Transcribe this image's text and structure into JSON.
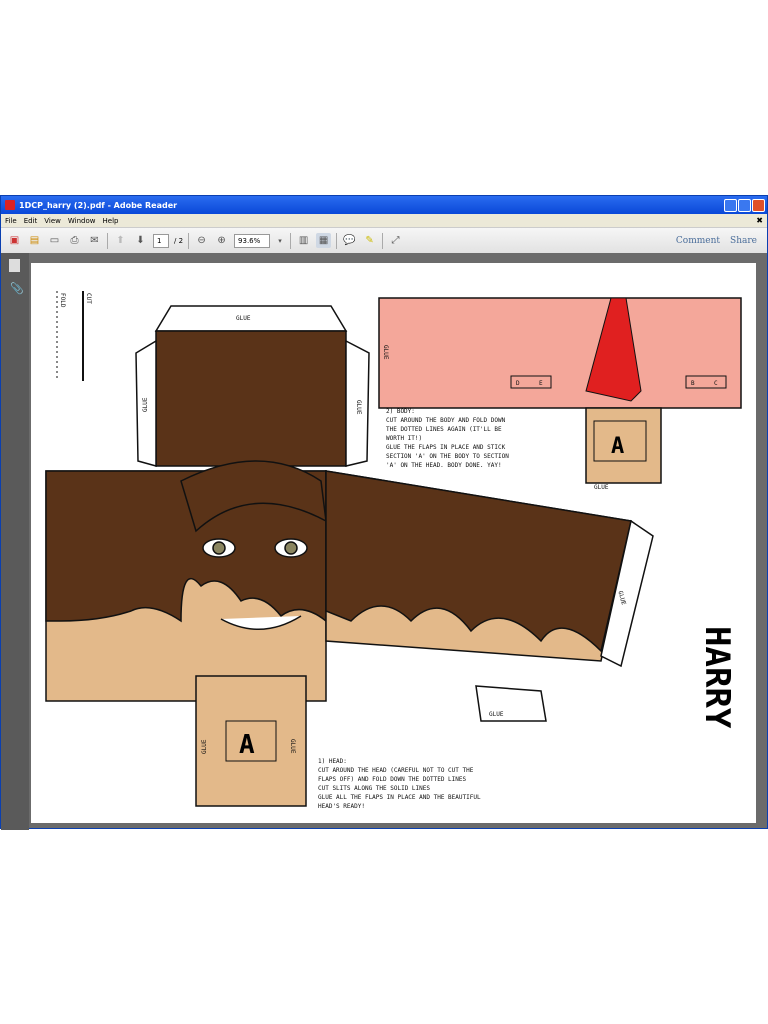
{
  "window": {
    "title": "1DCP_harry (2).pdf - Adobe Reader"
  },
  "menu": [
    "File",
    "Edit",
    "View",
    "Window",
    "Help"
  ],
  "toolbar": {
    "page_current": "1",
    "page_total": "/ 2",
    "zoom": "93.6%",
    "comment": "Comment",
    "share": "Share"
  },
  "papercraft": {
    "name": "HARRY",
    "glue": "GLUE",
    "fold": "FOLD",
    "cut": "CUT",
    "section": "A",
    "tab_d": "D",
    "tab_e": "E",
    "tab_b": "B",
    "tab_c": "C",
    "body_instructions": [
      "2) BODY:",
      "CUT AROUND THE BODY AND FOLD DOWN",
      "THE DOTTED LINES AGAIN (IT'LL BE",
      "WORTH IT!)",
      "GLUE THE FLAPS IN PLACE AND STICK",
      "SECTION 'A' ON THE BODY TO SECTION",
      "'A' ON THE HEAD. BODY DONE. YAY!"
    ],
    "head_instructions": [
      "1) HEAD:",
      "CUT AROUND THE HEAD (CAREFUL NOT TO CUT THE",
      "FLAPS OFF) AND FOLD DOWN THE DOTTED LINES",
      "CUT SLITS ALONG THE SOLID LINES",
      "GLUE ALL THE FLAPS IN PLACE AND THE BEAUTIFUL",
      "HEAD'S READY!"
    ]
  },
  "colors": {
    "hair": "#5a3318",
    "skin": "#e3b98a",
    "shirt": "#f4a79a",
    "collar": "#e02020",
    "titlebar": "#0a48d8"
  }
}
